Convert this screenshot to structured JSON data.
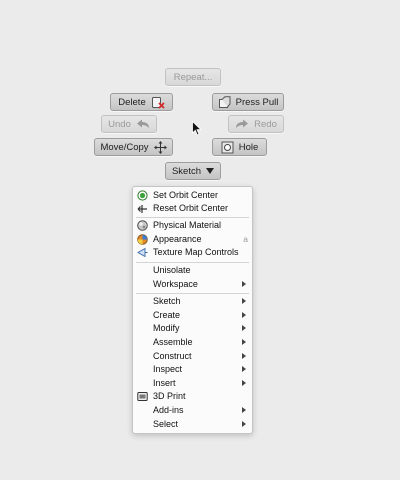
{
  "marking_menu": {
    "repeat_label": "Repeat...",
    "delete_label": "Delete",
    "press_pull_label": "Press Pull",
    "undo_label": "Undo",
    "redo_label": "Redo",
    "move_copy_label": "Move/Copy",
    "hole_label": "Hole",
    "sketch_dropdown_label": "Sketch"
  },
  "overflow_menu": {
    "items": [
      {
        "label": "Set Orbit Center",
        "icon": "orbit-center-icon"
      },
      {
        "label": "Reset Orbit Center",
        "icon": "reset-orbit-icon"
      },
      {
        "label": "Physical Material",
        "icon": "physical-material-icon"
      },
      {
        "label": "Appearance",
        "icon": "appearance-icon",
        "shortcut": "a"
      },
      {
        "label": "Texture Map Controls",
        "icon": "texture-map-icon"
      },
      {
        "label": "Unisolate"
      },
      {
        "label": "Workspace",
        "submenu": true
      },
      {
        "label": "Sketch",
        "submenu": true
      },
      {
        "label": "Create",
        "submenu": true
      },
      {
        "label": "Modify",
        "submenu": true
      },
      {
        "label": "Assemble",
        "submenu": true
      },
      {
        "label": "Construct",
        "submenu": true
      },
      {
        "label": "Inspect",
        "submenu": true
      },
      {
        "label": "Insert",
        "submenu": true
      },
      {
        "label": "3D Print",
        "icon": "3d-print-icon"
      },
      {
        "label": "Add-ins",
        "submenu": true
      },
      {
        "label": "Select",
        "submenu": true
      }
    ]
  },
  "colors": {
    "background": "#ebebeb",
    "orbit_icon": "#3aa33a",
    "delete_x": "#d22b2b",
    "appearance_icon": "#e08a2a"
  }
}
